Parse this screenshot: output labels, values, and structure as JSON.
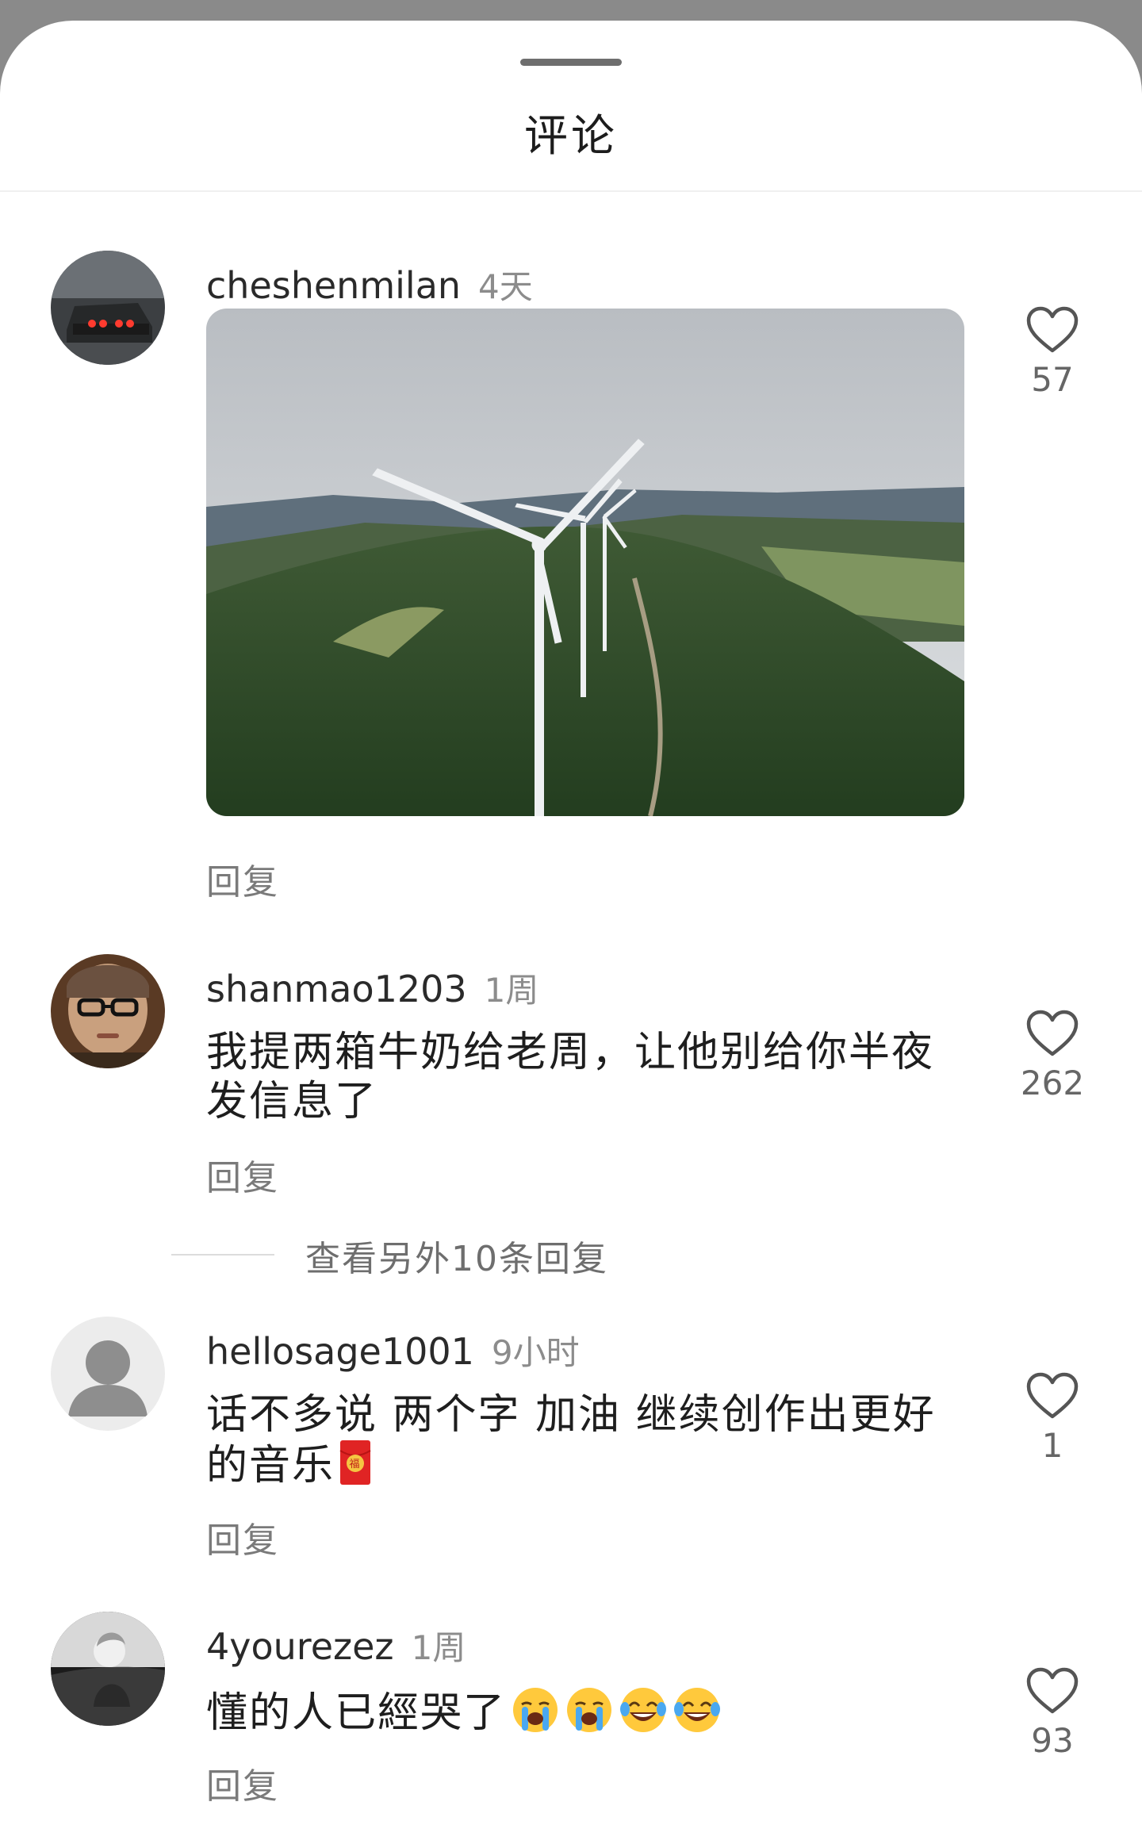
{
  "sheet": {
    "title": "评论"
  },
  "comments": [
    {
      "username": "cheshenmilan",
      "time": "4天",
      "text": "",
      "reply_label": "回复",
      "likes": "57",
      "has_photo": true
    },
    {
      "username": "shanmao1203",
      "time": "1周",
      "text_line1": "我提两箱牛奶给老周，让他别给你半夜",
      "text_line2": "发信息了",
      "reply_label": "回复",
      "likes": "262"
    },
    {
      "username": "hellosage1001",
      "time": "9小时",
      "text_line1": "话不多说 两个字 加油 继续创作出更好",
      "text_line2": "的音乐",
      "reply_label": "回复",
      "likes": "1"
    },
    {
      "username": "4yourezez",
      "time": "1周",
      "text": "懂的人已經哭了",
      "reply_label": "回复",
      "likes": "93"
    }
  ],
  "more_replies": "查看另外10条回复",
  "icons": {
    "like": "heart-outline-icon",
    "red_envelope": "red-envelope-emoji",
    "cry": "loudly-crying-face-emoji",
    "laugh": "tears-of-joy-emoji"
  }
}
